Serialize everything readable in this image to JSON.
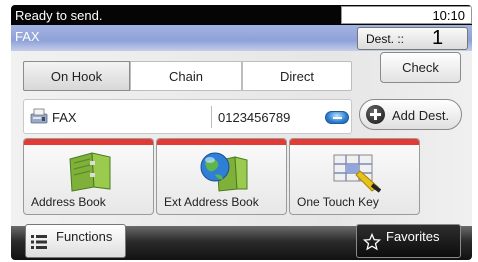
{
  "status": {
    "message": "Ready to send.",
    "time": "10:10"
  },
  "title": {
    "label": "FAX",
    "dest_label": "Dest. ::",
    "dest_count": "1"
  },
  "modes": [
    {
      "label": "On Hook",
      "active": true
    },
    {
      "label": "Chain",
      "active": false
    },
    {
      "label": "Direct",
      "active": false
    }
  ],
  "check_button": "Check",
  "destination": {
    "type": "FAX",
    "number": "0123456789",
    "icon": "fax-icon"
  },
  "add_dest_button": "Add Dest.",
  "tiles": [
    {
      "label": "Address Book",
      "icon": "address-book-icon"
    },
    {
      "label": "Ext Address Book",
      "icon": "ext-address-book-icon"
    },
    {
      "label": "One Touch Key",
      "icon": "one-touch-key-icon"
    }
  ],
  "bottom": {
    "functions": "Functions",
    "favorites": "Favorites"
  },
  "colors": {
    "status_bar": "#050505",
    "title_bar": "#8ea1d8",
    "tile_stripe": "#e23a34",
    "keypad": "#2e7fd0"
  }
}
